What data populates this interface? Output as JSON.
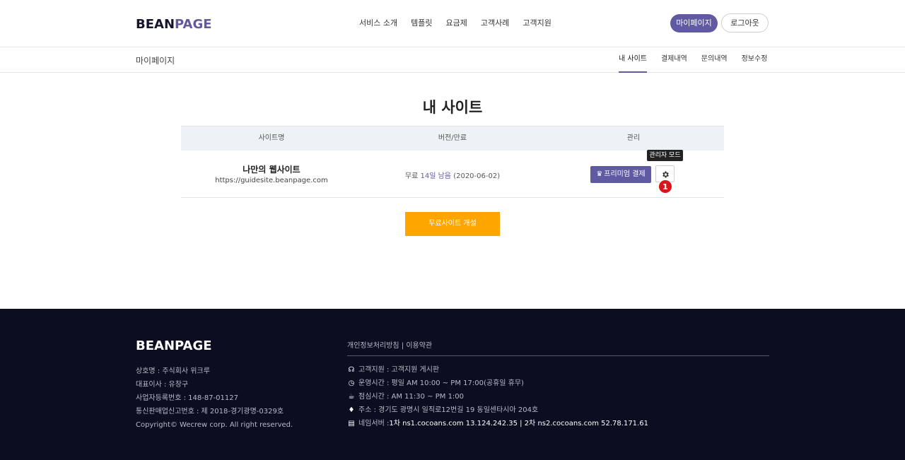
{
  "header": {
    "logo_main": "BEAN",
    "logo_accent": "PAGE",
    "nav": [
      "서비스 소개",
      "템플릿",
      "요금제",
      "고객사례",
      "고객지원"
    ],
    "mypage_label": "마이페이지",
    "logout_label": "로그아웃"
  },
  "subnav": {
    "title": "마이페이지",
    "tabs": [
      "내 사이트",
      "결제내역",
      "문의내역",
      "정보수정"
    ]
  },
  "main": {
    "title": "내 사이트",
    "columns": [
      "사이트명",
      "버전/만료",
      "관리"
    ],
    "rows": [
      {
        "name": "나만의 웹사이트",
        "url": "https://guidesite.beanpage.com",
        "version_prefix": "무료",
        "version_remaining": "14일 남음",
        "version_date": "(2020-06-02)",
        "premium_label": "프리미엄 결제",
        "tooltip": "관리자 모드",
        "badge": "1"
      }
    ],
    "create_label": "무료사이트 개설"
  },
  "footer": {
    "logo": "BEANPAGE",
    "info": [
      "상호명 : 주식회사 위크루",
      "대표이사 : 유창구",
      "사업자등록번호 : 148-87-01127",
      "통신판매업신고번호 : 제 2018-경기광명-0329호",
      "Copyright© Wecrew corp. All right reserved."
    ],
    "links": "개인정보처리방침 | 이용약관",
    "contact": {
      "support": "고객지원 : 고객지원 게시판",
      "hours": "운영시간 : 평일 AM 10:00 ~ PM 17:00(공휴일 휴무)",
      "lunch": "점심시간 : AM 11:30 ~ PM 1:00",
      "address": "주소 : 경기도 광명시 일직로12번길 19 동일센타시아 204호",
      "ns_label": "네임서버 : ",
      "ns_value": "1차 ns1.cocoans.com 13.124.242.35 | 2차 ns2.cocoans.com 52.78.171.61"
    }
  },
  "colors": {
    "brand": "#5f5aa2",
    "orange": "#ffa500",
    "footer_bg": "#0d0d22",
    "badge": "#d9141b"
  }
}
